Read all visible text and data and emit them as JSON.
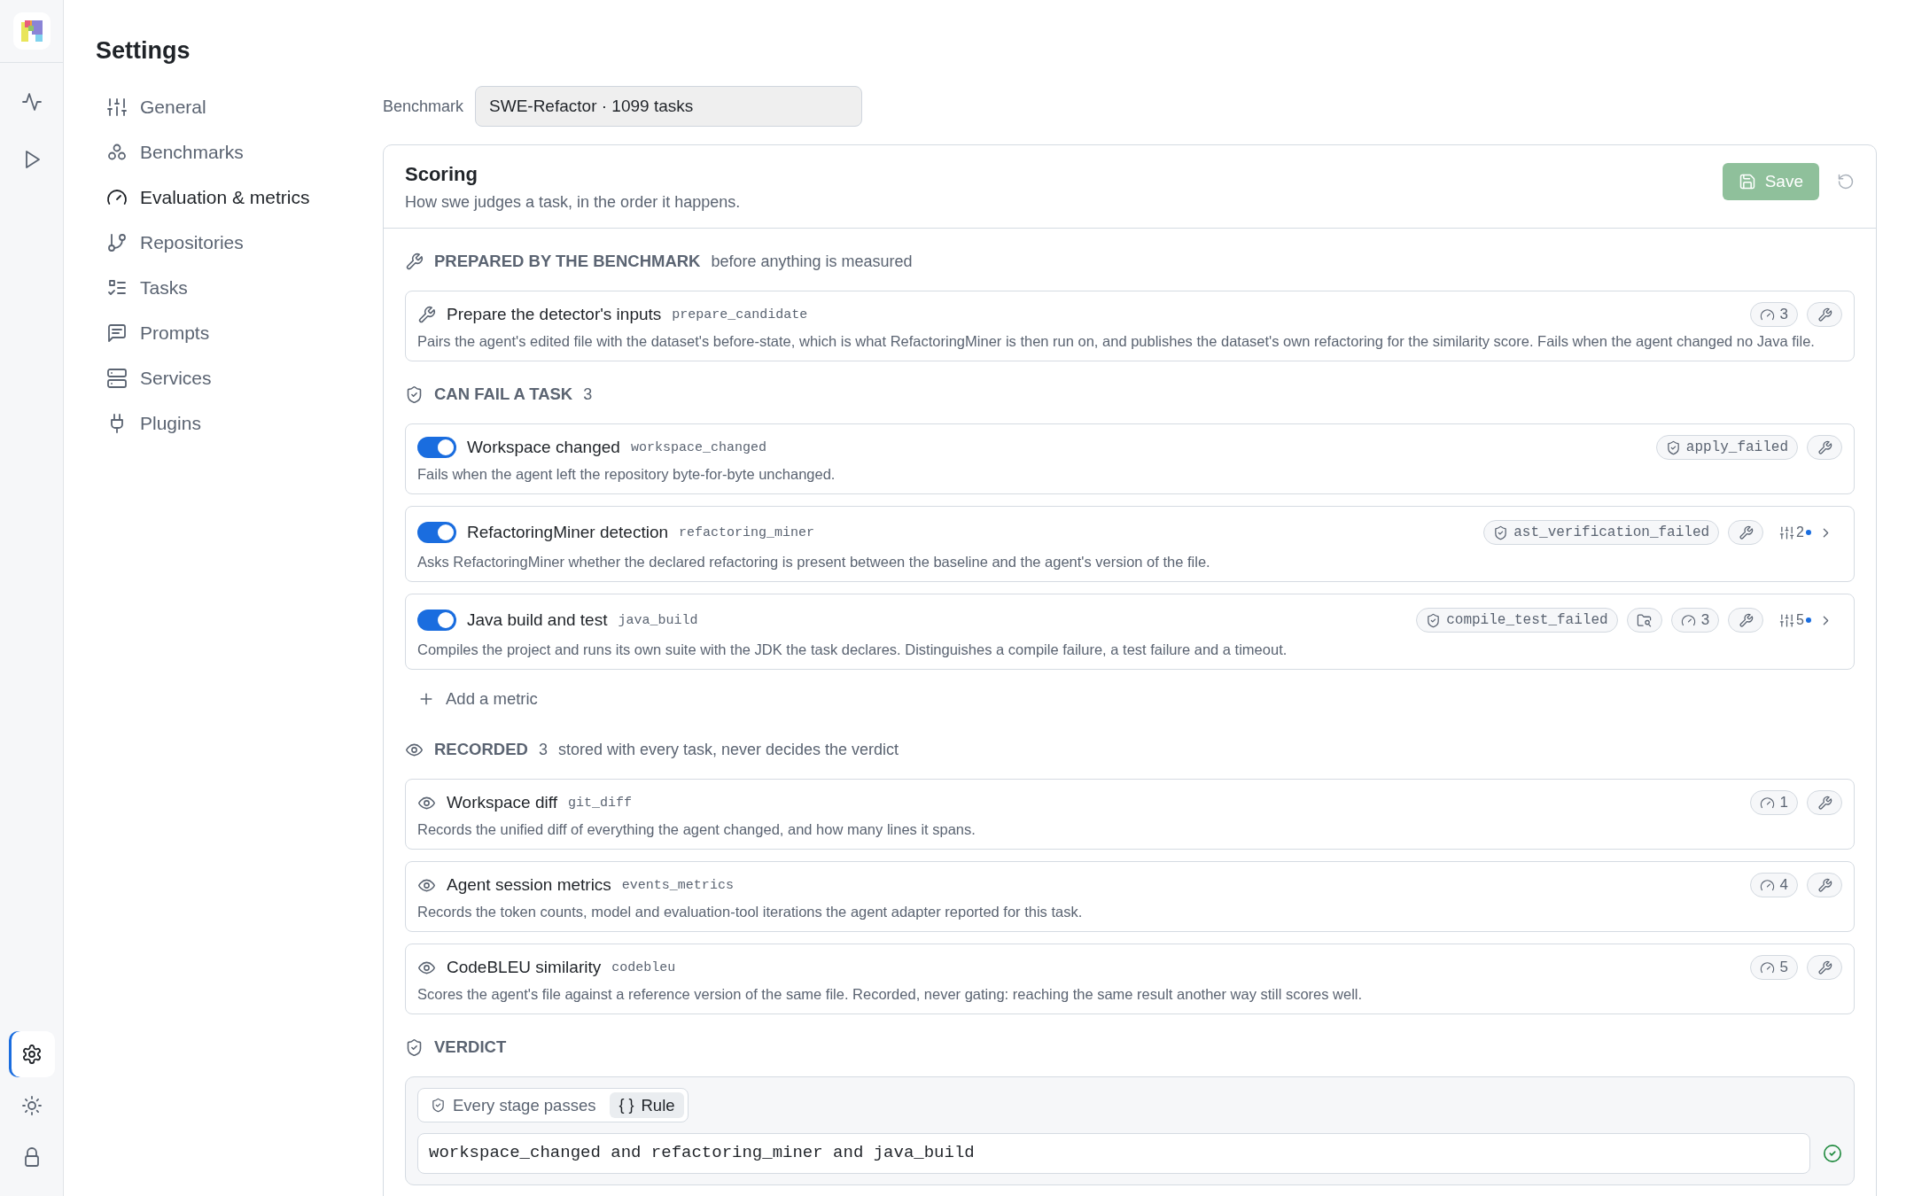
{
  "rail_top": [
    {
      "kind": "activity",
      "selected": false
    },
    {
      "kind": "run",
      "selected": false
    }
  ],
  "rail_bottom": [
    {
      "kind": "settings",
      "selected": true
    },
    {
      "kind": "theme",
      "selected": false
    },
    {
      "kind": "lock",
      "selected": false
    }
  ],
  "title": "Settings",
  "nav": [
    {
      "kind": "sliders",
      "label": "General",
      "selected": false
    },
    {
      "kind": "clusters",
      "label": "Benchmarks",
      "selected": false
    },
    {
      "kind": "gauge",
      "label": "Evaluation & metrics",
      "selected": true
    },
    {
      "kind": "branch",
      "label": "Repositories",
      "selected": false
    },
    {
      "kind": "checklist",
      "label": "Tasks",
      "selected": false
    },
    {
      "kind": "chat",
      "label": "Prompts",
      "selected": false
    },
    {
      "kind": "server",
      "label": "Services",
      "selected": false
    },
    {
      "kind": "plug",
      "label": "Plugins",
      "selected": false
    }
  ],
  "benchmark": {
    "label": "Benchmark",
    "value": "SWE-Refactor · 1099 tasks"
  },
  "scoring": {
    "title": "Scoring",
    "subtitle": "How swe judges a task, in the order it happens.",
    "save": {
      "label": "Save",
      "disabled": true
    },
    "sections": [
      {
        "kind": "prepared",
        "title": "PREPARED BY THE BENCHMARK",
        "note": "before anything is measured",
        "items": [
          {
            "kind": "step",
            "title": "Prepare the detector's inputs",
            "code": "prepare_candidate",
            "description": "Pairs the agent's edited file with the dataset's before-state, which is what RefactoringMiner is then run on, and publishes the dataset's own refactoring for the similarity score. Fails when the agent changed no Java file.",
            "chips": [
              {
                "kind": "gauge",
                "text": "3"
              },
              {
                "kind": "tool"
              }
            ]
          }
        ]
      },
      {
        "kind": "gates",
        "title": "CAN FAIL A TASK",
        "count": "3",
        "add": "Add a metric",
        "items": [
          {
            "kind": "gate",
            "on": true,
            "title": "Workspace changed",
            "code": "workspace_changed",
            "description": "Fails when the agent left the repository byte-for-byte unchanged.",
            "chips": [
              {
                "kind": "outcome",
                "text": "apply_failed"
              },
              {
                "kind": "tool"
              }
            ]
          },
          {
            "kind": "gate",
            "on": true,
            "title": "RefactoringMiner detection",
            "code": "refactoring_miner",
            "description": "Asks RefactoringMiner whether the declared refactoring is present between the baseline and the agent's version of the file.",
            "chips": [
              {
                "kind": "outcome",
                "text": "ast_verification_failed"
              },
              {
                "kind": "tool"
              }
            ],
            "params": {
              "count": "2",
              "modified": true
            }
          },
          {
            "kind": "gate",
            "on": true,
            "title": "Java build and test",
            "code": "java_build",
            "description": "Compiles the project and runs its own suite with the JDK the task declares. Distinguishes a compile failure, a test failure and a timeout.",
            "chips": [
              {
                "kind": "outcome",
                "text": "compile_test_failed"
              },
              {
                "kind": "files"
              },
              {
                "kind": "gauge",
                "text": "3"
              },
              {
                "kind": "tool"
              }
            ],
            "params": {
              "count": "5",
              "modified": true
            }
          }
        ]
      },
      {
        "kind": "recorded",
        "title": "RECORDED",
        "count": "3",
        "note": "stored with every task, never decides the verdict",
        "items": [
          {
            "kind": "record",
            "title": "Workspace diff",
            "code": "git_diff",
            "description": "Records the unified diff of everything the agent changed, and how many lines it spans.",
            "chips": [
              {
                "kind": "gauge",
                "text": "1"
              },
              {
                "kind": "tool"
              }
            ]
          },
          {
            "kind": "record",
            "title": "Agent session metrics",
            "code": "events_metrics",
            "description": "Records the token counts, model and evaluation-tool iterations the agent adapter reported for this task.",
            "chips": [
              {
                "kind": "gauge",
                "text": "4"
              },
              {
                "kind": "tool"
              }
            ]
          },
          {
            "kind": "record",
            "title": "CodeBLEU similarity",
            "code": "codebleu",
            "description": "Scores the agent's file against a reference version of the same file. Recorded, never gating: reaching the same result another way still scores well.",
            "chips": [
              {
                "kind": "gauge",
                "text": "5"
              },
              {
                "kind": "tool"
              }
            ]
          }
        ]
      }
    ],
    "verdict": {
      "title": "VERDICT",
      "modes": [
        {
          "kind": "stages",
          "label": "Every stage passes",
          "selected": false
        },
        {
          "kind": "rule",
          "glyph": "{ }",
          "label": "Rule",
          "selected": true
        }
      ],
      "rule": "workspace_changed and refactoring_miner and java_build",
      "valid": true
    }
  }
}
